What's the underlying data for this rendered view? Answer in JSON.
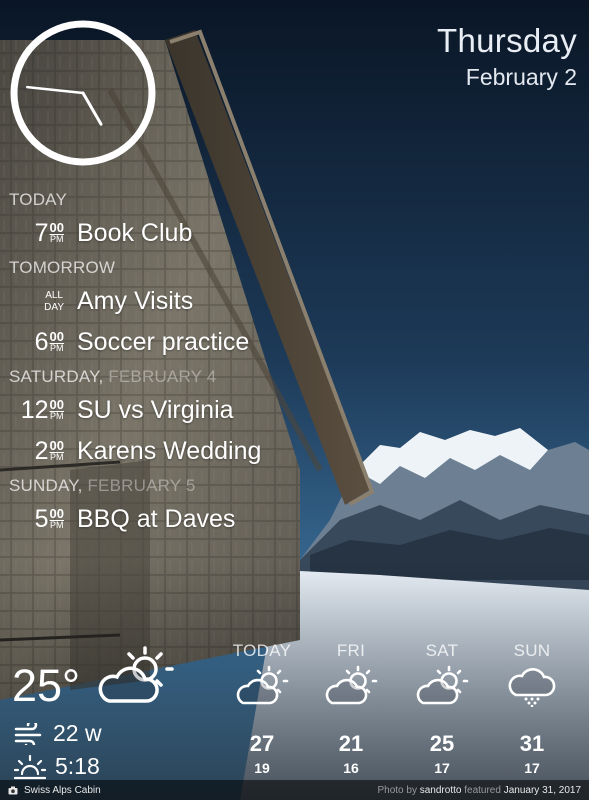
{
  "date": {
    "weekday": "Thursday",
    "date": "February 2"
  },
  "clock": {
    "hour_hand_deg": 150,
    "minute_hand_deg": 276
  },
  "agenda": [
    {
      "heading": "TODAY",
      "heading_muted": "",
      "events": [
        {
          "hour": "7",
          "minute": "00",
          "ampm": "PM",
          "title": "Book Club"
        }
      ]
    },
    {
      "heading": "TOMORROW",
      "heading_muted": "",
      "events": [
        {
          "allday": true,
          "allday_top": "ALL",
          "allday_bottom": "DAY",
          "title": "Amy Visits"
        },
        {
          "hour": "6",
          "minute": "00",
          "ampm": "PM",
          "title": "Soccer practice"
        }
      ]
    },
    {
      "heading": "SATURDAY, ",
      "heading_muted": "FEBRUARY 4",
      "events": [
        {
          "hour": "12",
          "minute": "00",
          "ampm": "PM",
          "title": "SU vs Virginia"
        },
        {
          "hour": "2",
          "minute": "00",
          "ampm": "PM",
          "title": "Karens Wedding"
        }
      ]
    },
    {
      "heading": "SUNDAY, ",
      "heading_muted": "FEBRUARY 5",
      "events": [
        {
          "hour": "5",
          "minute": "00",
          "ampm": "PM",
          "title": "BBQ at Daves"
        }
      ]
    }
  ],
  "current": {
    "temperature": "25°",
    "icon": "partly-cloudy-icon",
    "wind": "22 w",
    "sunset": "5:18"
  },
  "forecast": [
    {
      "label": "TODAY",
      "icon": "partly-cloudy-icon",
      "high": "27",
      "low": "19"
    },
    {
      "label": "FRI",
      "icon": "partly-cloudy-icon",
      "high": "21",
      "low": "16"
    },
    {
      "label": "SAT",
      "icon": "partly-cloudy-icon",
      "high": "25",
      "low": "17"
    },
    {
      "label": "SUN",
      "icon": "snow-icon",
      "high": "31",
      "low": "17"
    }
  ],
  "footer": {
    "location": "Swiss Alps Cabin",
    "photo_prefix": "Photo by ",
    "photographer": "sandrotto",
    "featured_label": " featured ",
    "featured_date": "January 31, 2017"
  },
  "colors": {
    "sky_top": "#0a1626",
    "sky_bottom": "#3a6c96",
    "wood": "#6f6a60",
    "snow": "#dfe8f1"
  }
}
